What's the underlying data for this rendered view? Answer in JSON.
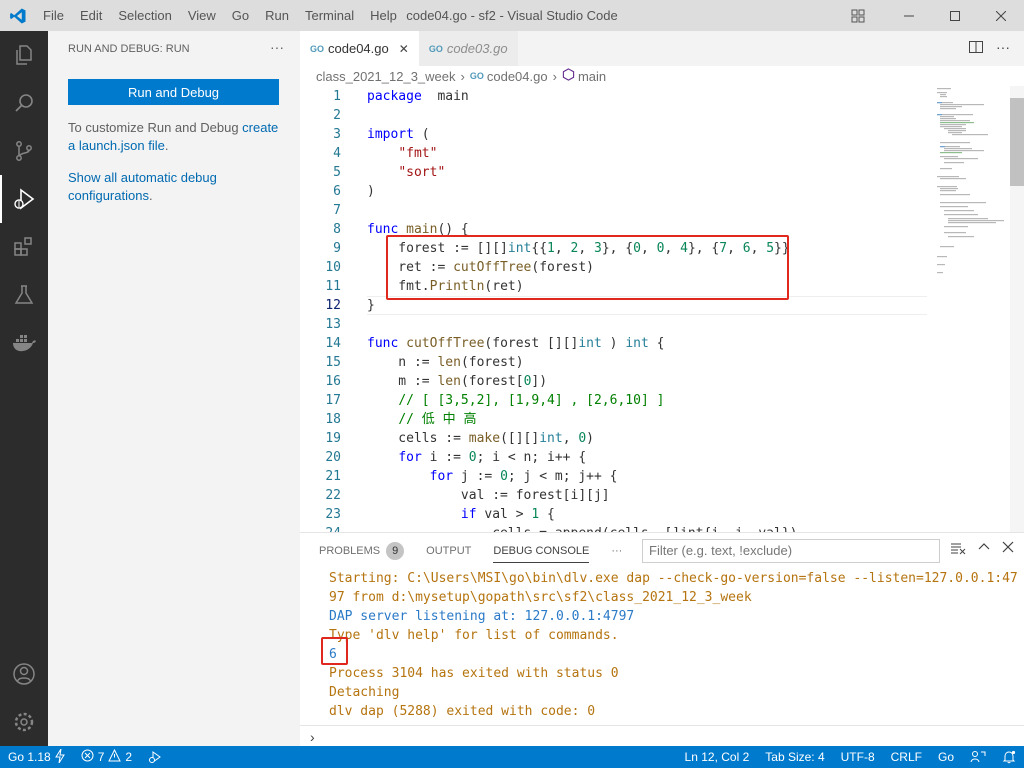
{
  "titlebar": {
    "menu": [
      "File",
      "Edit",
      "Selection",
      "View",
      "Go",
      "Run",
      "Terminal",
      "Help"
    ],
    "title": "code04.go - sf2 - Visual Studio Code"
  },
  "sidebar": {
    "header": "RUN AND DEBUG: RUN",
    "run_button": "Run and Debug",
    "customize_text": "To customize Run and Debug ",
    "customize_link": "create a launch.json file",
    "customize_end": ".",
    "show_all_link": "Show all automatic debug configurations",
    "show_all_end": "."
  },
  "tabs": [
    {
      "label": "code04.go",
      "active": true,
      "icon": "GO"
    },
    {
      "label": "code03.go",
      "active": false,
      "icon": "GO"
    }
  ],
  "breadcrumb": {
    "folder": "class_2021_12_3_week",
    "file": "code04.go",
    "symbol": "main"
  },
  "editor": {
    "lines": [
      {
        "n": "1",
        "tokens": [
          [
            "kw",
            "package"
          ],
          [
            "",
            "  main"
          ]
        ]
      },
      {
        "n": "2",
        "tokens": []
      },
      {
        "n": "3",
        "tokens": [
          [
            "kw",
            "import"
          ],
          [
            "",
            " ("
          ]
        ]
      },
      {
        "n": "4",
        "tokens": [
          [
            "",
            "    "
          ],
          [
            "str",
            "\"fmt\""
          ]
        ]
      },
      {
        "n": "5",
        "tokens": [
          [
            "",
            "    "
          ],
          [
            "str",
            "\"sort\""
          ]
        ]
      },
      {
        "n": "6",
        "tokens": [
          [
            "",
            ")"
          ]
        ]
      },
      {
        "n": "7",
        "tokens": []
      },
      {
        "n": "8",
        "tokens": [
          [
            "kw",
            "func"
          ],
          [
            "",
            " "
          ],
          [
            "fn",
            "main"
          ],
          [
            "",
            "() {"
          ]
        ]
      },
      {
        "n": "9",
        "tokens": [
          [
            "",
            "    forest := [][]"
          ],
          [
            "typ",
            "int"
          ],
          [
            "",
            "{{"
          ],
          [
            "num",
            "1"
          ],
          [
            "",
            ", "
          ],
          [
            "num",
            "2"
          ],
          [
            "",
            ", "
          ],
          [
            "num",
            "3"
          ],
          [
            "",
            "}, {"
          ],
          [
            "num",
            "0"
          ],
          [
            "",
            ", "
          ],
          [
            "num",
            "0"
          ],
          [
            "",
            ", "
          ],
          [
            "num",
            "4"
          ],
          [
            "",
            "}, {"
          ],
          [
            "num",
            "7"
          ],
          [
            "",
            ", "
          ],
          [
            "num",
            "6"
          ],
          [
            "",
            ", "
          ],
          [
            "num",
            "5"
          ],
          [
            "",
            "}}"
          ]
        ]
      },
      {
        "n": "10",
        "tokens": [
          [
            "",
            "    ret := "
          ],
          [
            "fn",
            "cutOffTree"
          ],
          [
            "",
            "(forest)"
          ]
        ]
      },
      {
        "n": "11",
        "tokens": [
          [
            "",
            "    fmt."
          ],
          [
            "fn",
            "Println"
          ],
          [
            "",
            "(ret)"
          ]
        ]
      },
      {
        "n": "12",
        "tokens": [
          [
            "",
            "}"
          ]
        ]
      },
      {
        "n": "13",
        "tokens": []
      },
      {
        "n": "14",
        "tokens": [
          [
            "kw",
            "func"
          ],
          [
            "",
            " "
          ],
          [
            "fn",
            "cutOffTree"
          ],
          [
            "",
            "(forest [][]"
          ],
          [
            "typ",
            "int"
          ],
          [
            "",
            " ) "
          ],
          [
            "typ",
            "int"
          ],
          [
            "",
            " {"
          ]
        ]
      },
      {
        "n": "15",
        "tokens": [
          [
            "",
            "    n := "
          ],
          [
            "fn",
            "len"
          ],
          [
            "",
            "(forest)"
          ]
        ]
      },
      {
        "n": "16",
        "tokens": [
          [
            "",
            "    m := "
          ],
          [
            "fn",
            "len"
          ],
          [
            "",
            "(forest["
          ],
          [
            "num",
            "0"
          ],
          [
            "",
            "])"
          ]
        ]
      },
      {
        "n": "17",
        "tokens": [
          [
            "",
            "    "
          ],
          [
            "cmt",
            "// [ [3,5,2], [1,9,4] , [2,6,10] ]"
          ]
        ]
      },
      {
        "n": "18",
        "tokens": [
          [
            "",
            "    "
          ],
          [
            "cmt",
            "// 低 中 高"
          ]
        ]
      },
      {
        "n": "19",
        "tokens": [
          [
            "",
            "    cells := "
          ],
          [
            "fn",
            "make"
          ],
          [
            "",
            "([][]"
          ],
          [
            "typ",
            "int"
          ],
          [
            "",
            ", "
          ],
          [
            "num",
            "0"
          ],
          [
            "",
            ")"
          ]
        ]
      },
      {
        "n": "20",
        "tokens": [
          [
            "",
            "    "
          ],
          [
            "kw",
            "for"
          ],
          [
            "",
            " i := "
          ],
          [
            "num",
            "0"
          ],
          [
            "",
            "; i < n; i++ {"
          ]
        ]
      },
      {
        "n": "21",
        "tokens": [
          [
            "",
            "        "
          ],
          [
            "kw",
            "for"
          ],
          [
            "",
            " j := "
          ],
          [
            "num",
            "0"
          ],
          [
            "",
            "; j < m; j++ {"
          ]
        ]
      },
      {
        "n": "22",
        "tokens": [
          [
            "",
            "            val := forest[i][j]"
          ]
        ]
      },
      {
        "n": "23",
        "tokens": [
          [
            "",
            "            "
          ],
          [
            "kw",
            "if"
          ],
          [
            "",
            " val > "
          ],
          [
            "num",
            "1"
          ],
          [
            "",
            " {"
          ]
        ]
      },
      {
        "n": "24",
        "tokens": [
          [
            "",
            "                cells = append(cells, []int{i, j, val})"
          ]
        ]
      }
    ],
    "current_line": "12"
  },
  "panel": {
    "tabs": [
      {
        "label": "PROBLEMS",
        "badge": "9"
      },
      {
        "label": "OUTPUT"
      },
      {
        "label": "DEBUG CONSOLE",
        "active": true
      }
    ],
    "filter_placeholder": "Filter (e.g. text, !exclude)",
    "console": [
      {
        "text": "Starting: C:\\Users\\MSI\\go\\bin\\dlv.exe dap --check-go-version=false --listen=127.0.0.1:47",
        "color": "orange"
      },
      {
        "text": "97 from d:\\mysetup\\gopath\\src\\sf2\\class_2021_12_3_week",
        "color": "orange"
      },
      {
        "text": "DAP server listening at: 127.0.0.1:4797",
        "color": "blue"
      },
      {
        "text": "Type 'dlv help' for list of commands.",
        "color": "orange"
      },
      {
        "text": "6",
        "color": "blue"
      },
      {
        "text": "Process 3104 has exited with status 0",
        "color": "orange"
      },
      {
        "text": "Detaching",
        "color": "orange"
      },
      {
        "text": "dlv dap (5288) exited with code: 0",
        "color": "orange"
      }
    ]
  },
  "statusbar": {
    "go_version": "Go 1.18",
    "errors": "7",
    "warnings": "2",
    "position": "Ln 12, Col 2",
    "tab_size": "Tab Size: 4",
    "encoding": "UTF-8",
    "eol": "CRLF",
    "language": "Go"
  },
  "colors": {
    "accent": "#007acc",
    "activity_bar": "#2c2c2c",
    "highlight_box": "#e0281f"
  }
}
